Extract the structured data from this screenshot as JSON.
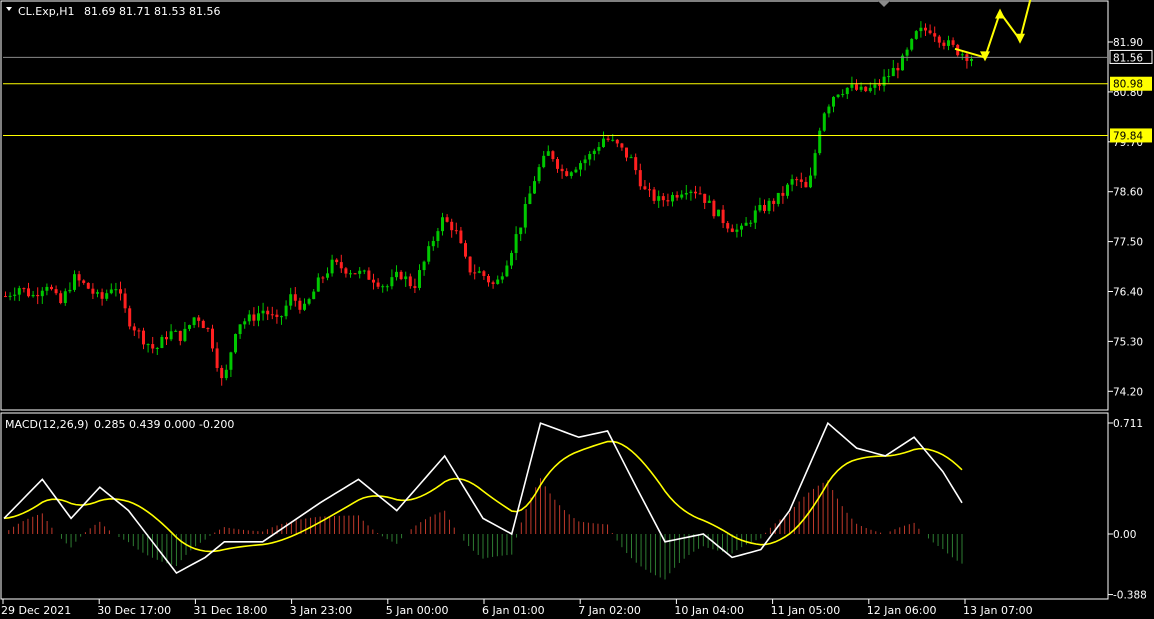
{
  "header": {
    "symbol_label": "CL.Exp,H1",
    "ohlc": "81.69 81.71 81.53 81.56"
  },
  "macd": {
    "label": "MACD(12,26,9)",
    "values": "0.285 0.439 0.000 -0.200",
    "y_ticks": [
      "0.711",
      "0.00",
      "-0.388"
    ],
    "histogram_up_color": "#c0392b",
    "histogram_down_color": "#2e7d32",
    "main_line_color": "#ffffff",
    "signal_line_color": "#ffff00"
  },
  "price_axis": {
    "ticks": [
      "81.90",
      "80.80",
      "79.70",
      "78.60",
      "77.50",
      "76.40",
      "75.30",
      "74.20"
    ],
    "current_price_label": "81.56",
    "levels": [
      {
        "value": 80.98,
        "label": "80.98",
        "color": "#ffff00"
      },
      {
        "value": 79.84,
        "label": "79.84",
        "color": "#ffff00"
      }
    ]
  },
  "time_axis": {
    "labels": [
      "29 Dec 2021",
      "30 Dec 17:00",
      "31 Dec 18:00",
      "3 Jan 23:00",
      "5 Jan 00:00",
      "6 Jan 01:00",
      "7 Jan 02:00",
      "10 Jan 04:00",
      "11 Jan 05:00",
      "12 Jan 06:00",
      "13 Jan 07:00"
    ]
  },
  "colors": {
    "bull_candle": "#00c800",
    "bear_candle": "#ff2020",
    "background": "#000000",
    "grid_border": "#ffffff"
  },
  "chart_data": {
    "type": "candlestick",
    "title": "CL.Exp,H1",
    "x_labels": [
      "29 Dec 2021",
      "30 Dec 17:00",
      "31 Dec 18:00",
      "3 Jan 23:00",
      "5 Jan 00:00",
      "6 Jan 01:00",
      "7 Jan 02:00",
      "10 Jan 04:00",
      "11 Jan 05:00",
      "12 Jan 06:00",
      "13 Jan 07:00"
    ],
    "ylim": [
      74.0,
      82.8
    ],
    "close_path": [
      76.3,
      76.5,
      76.3,
      76.6,
      76.1,
      76.7,
      76.5,
      76.2,
      76.6,
      75.8,
      75.4,
      75.1,
      75.5,
      75.4,
      75.9,
      75.5,
      74.3,
      75.7,
      75.8,
      76.0,
      75.7,
      76.3,
      76.0,
      76.6,
      77.0,
      76.9,
      76.8,
      76.7,
      76.5,
      76.8,
      76.5,
      77.2,
      78.0,
      77.8,
      76.9,
      76.8,
      76.5,
      77.2,
      78.0,
      79.0,
      79.5,
      79.0,
      79.2,
      79.4,
      79.8,
      79.6,
      79.3,
      78.6,
      78.4,
      78.5,
      78.7,
      78.6,
      78.2,
      77.9,
      77.7,
      78.1,
      78.3,
      78.5,
      78.9,
      78.6,
      80.3,
      80.8,
      80.9,
      80.8,
      80.9,
      81.2,
      81.5,
      82.1,
      82.2,
      81.9,
      81.7,
      81.56
    ],
    "levels": [
      80.98,
      79.84
    ],
    "last_price": 81.56,
    "projection_arrows": [
      "down",
      "up",
      "down",
      "up"
    ]
  }
}
